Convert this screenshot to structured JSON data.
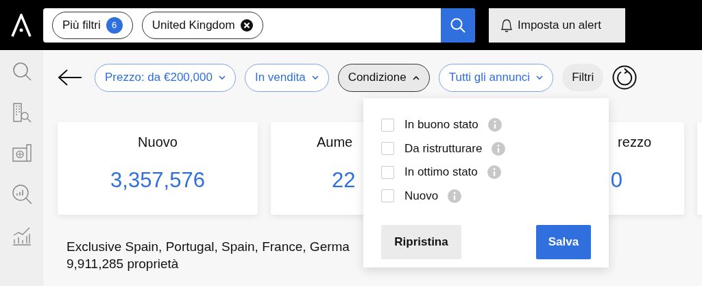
{
  "search_bar": {
    "chips": [
      {
        "kind": "count",
        "label": "Più filtri",
        "count": "6"
      },
      {
        "kind": "removable",
        "label": "United Kingdom"
      }
    ]
  },
  "alert_button": {
    "label": "Imposta un alert"
  },
  "filters": [
    {
      "label": "Prezzo: da €200,000",
      "selected": false,
      "expanded": false,
      "kind": "dropdown"
    },
    {
      "label": "In vendita",
      "selected": false,
      "expanded": false,
      "kind": "dropdown"
    },
    {
      "label": "Condizione",
      "selected": true,
      "expanded": true,
      "kind": "dropdown"
    },
    {
      "label": "Tutti gli annunci",
      "selected": false,
      "expanded": false,
      "kind": "dropdown"
    },
    {
      "label": "Filtri",
      "kind": "plain"
    }
  ],
  "cards": [
    {
      "title": "Nuovo",
      "value": "3,357,576"
    },
    {
      "title": "Aume",
      "value": "22"
    },
    {
      "title": "rezzo",
      "value": "0"
    }
  ],
  "summary": {
    "regions": "Exclusive Spain, Portugal, Spain, France, Germa",
    "count": "9,911,285 proprietà"
  },
  "condition_menu": {
    "options": [
      {
        "label": "In buono stato",
        "checked": false
      },
      {
        "label": "Da ristrutturare",
        "checked": false
      },
      {
        "label": "In ottimo stato",
        "checked": false
      },
      {
        "label": "Nuovo",
        "checked": false
      }
    ],
    "reset_button": "Ripristina",
    "save_button": "Salva"
  }
}
